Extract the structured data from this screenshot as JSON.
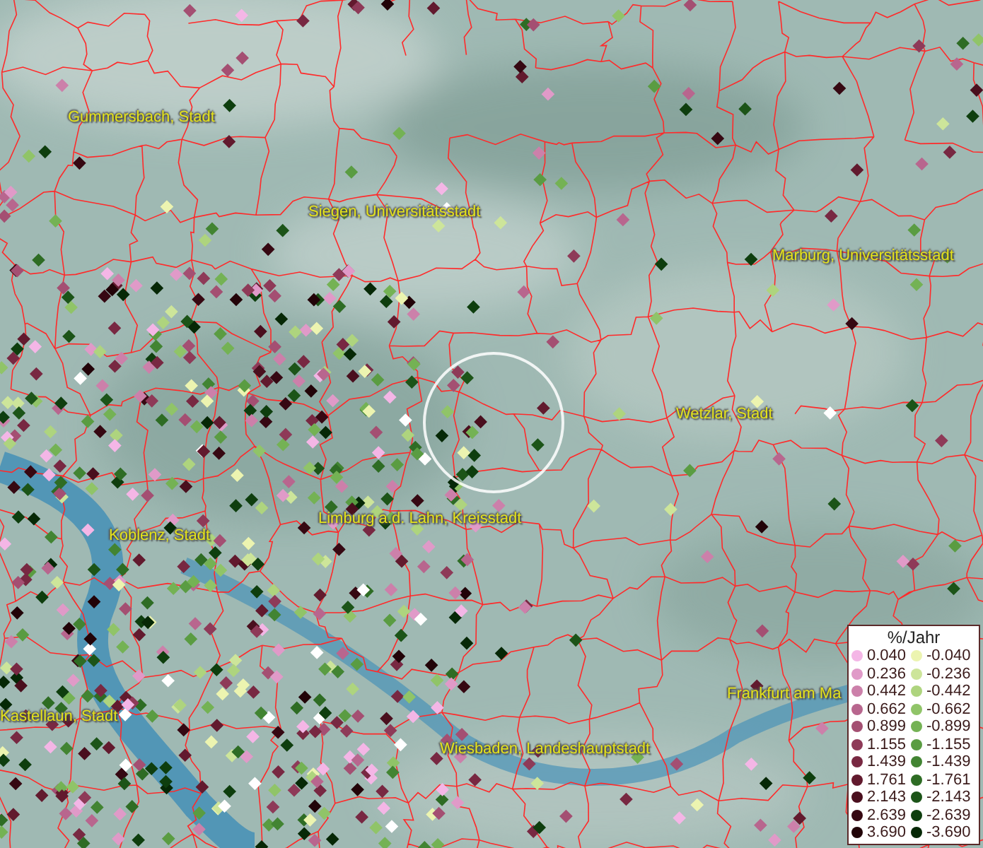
{
  "cities": [
    {
      "name": "Gummersbach, Stadt"
    },
    {
      "name": "Siegen, Universitätsstadt"
    },
    {
      "name": "Marburg, Universitätsstadt"
    },
    {
      "name": "Wetzlar, Stadt"
    },
    {
      "name": "Limburg a.d. Lahn, Kreisstadt"
    },
    {
      "name": "Koblenz, Stadt"
    },
    {
      "name": "Frankfurt am Ma"
    },
    {
      "name": "Wiesbaden, Landeshauptstadt"
    },
    {
      "name": "Kastellaun, Stadt"
    }
  ],
  "legend": {
    "title": "%/Jahr",
    "entries": [
      {
        "label": "0.040",
        "color": "#f4b6e6"
      },
      {
        "label": "0.236",
        "color": "#e09ac8"
      },
      {
        "label": "0.442",
        "color": "#cc80aa"
      },
      {
        "label": "0.662",
        "color": "#b8668e"
      },
      {
        "label": "0.899",
        "color": "#a44f72"
      },
      {
        "label": "1.155",
        "color": "#8e3a58"
      },
      {
        "label": "1.439",
        "color": "#782842"
      },
      {
        "label": "1.761",
        "color": "#621a2e"
      },
      {
        "label": "2.143",
        "color": "#4a0f1e"
      },
      {
        "label": "2.639",
        "color": "#360812"
      },
      {
        "label": "3.690",
        "color": "#220308"
      },
      {
        "label": "-0.040",
        "color": "#ecf4b0"
      },
      {
        "label": "-0.236",
        "color": "#cde59a"
      },
      {
        "label": "-0.442",
        "color": "#aed47e"
      },
      {
        "label": "-0.662",
        "color": "#90c468"
      },
      {
        "label": "-0.899",
        "color": "#74b254"
      },
      {
        "label": "-1.155",
        "color": "#5a9c42"
      },
      {
        "label": "-1.439",
        "color": "#428432"
      },
      {
        "label": "-1.761",
        "color": "#2e6c24"
      },
      {
        "label": "-2.143",
        "color": "#1c5418"
      },
      {
        "label": "-2.639",
        "color": "#0e3e0e"
      },
      {
        "label": "-3.690",
        "color": "#062806"
      }
    ]
  }
}
